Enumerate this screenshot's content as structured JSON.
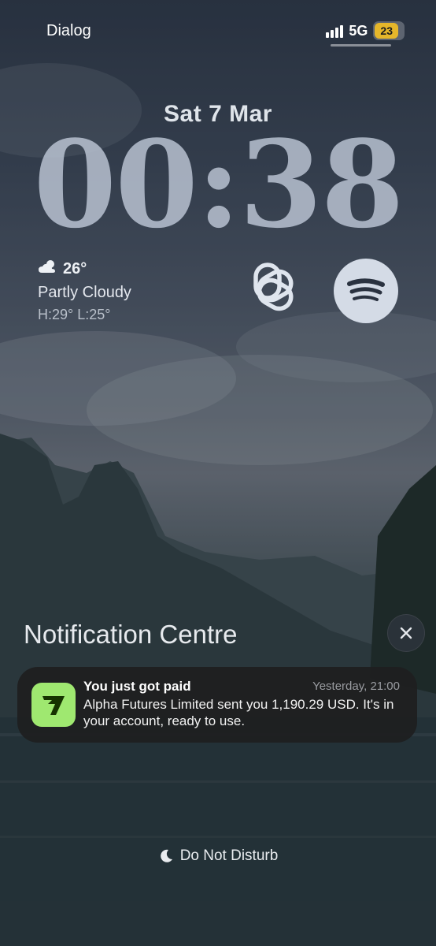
{
  "status_bar": {
    "carrier": "Dialog",
    "network": "5G",
    "battery": "23"
  },
  "lock_screen": {
    "date": "Sat 7 Mar",
    "time": "00:38"
  },
  "weather": {
    "temperature": "26°",
    "condition": "Partly Cloudy",
    "high_low": "H:29° L:25°",
    "icon": "partly-cloudy-icon"
  },
  "widgets": [
    {
      "icon": "chatgpt-icon"
    },
    {
      "icon": "spotify-icon"
    }
  ],
  "notification_centre": {
    "title": "Notification Centre",
    "notification": {
      "app_icon": "wise-app-icon",
      "title": "You just got paid",
      "time": "Yesterday, 21:00",
      "body": "Alpha Futures Limited sent you 1,190.29 USD. It's in your account, ready to use."
    }
  },
  "focus": {
    "label": "Do Not Disturb",
    "icon": "moon-icon"
  },
  "colors": {
    "battery": "#e5b62a",
    "wise_green": "#9fe870",
    "wise_dark": "#163300"
  }
}
